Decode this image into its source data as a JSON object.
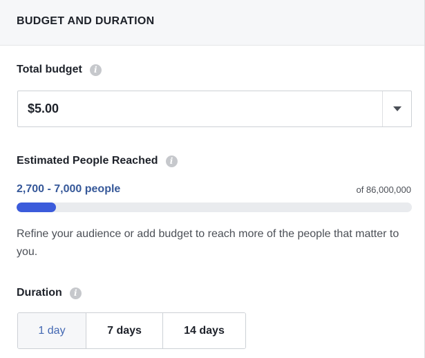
{
  "header": {
    "title": "BUDGET AND DURATION"
  },
  "budget": {
    "label": "Total budget",
    "info_icon": "info-icon",
    "selected_value": "$5.00"
  },
  "reach": {
    "label": "Estimated People Reached",
    "info_icon": "info-icon",
    "range_text": "2,700 - 7,000 people",
    "total_text": "of 86,000,000",
    "progress_fraction": 0.1,
    "accent_color": "#3b5bdb"
  },
  "helper": {
    "text": "Refine your audience or add budget to reach more of the people that matter to you."
  },
  "duration": {
    "label": "Duration",
    "info_icon": "info-icon",
    "options": [
      "1 day",
      "7 days",
      "14 days"
    ],
    "selected": "1 day"
  }
}
